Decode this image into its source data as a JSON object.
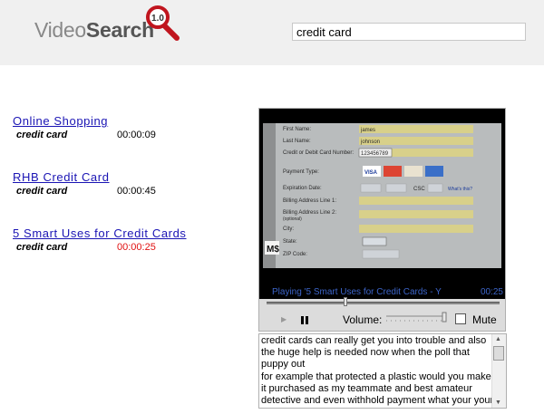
{
  "app": {
    "logo_light": "Video",
    "logo_bold": "Search",
    "version": "1.0"
  },
  "search": {
    "value": "credit card"
  },
  "results": [
    {
      "title": "Online  Shopping",
      "tag": "credit card",
      "time": "00:00:09",
      "active": false
    },
    {
      "title": "RHB  Credit  Card",
      "tag": "credit card",
      "time": "00:00:45",
      "active": false
    },
    {
      "title": "5  Smart  Uses  for  Credit  Cards",
      "tag": "credit card",
      "time": "00:00:25",
      "active": true
    }
  ],
  "player": {
    "now_playing": "Playing '5 Smart Uses for Credit Cards - Y",
    "elapsed": "00:25",
    "seek_fraction": 0.34,
    "volume_label": "Volume:",
    "volume_fraction": 1.0,
    "mute_label": "Mute",
    "muted": false,
    "frame_form": {
      "first_name_label": "First Name:",
      "first_name_value": "james",
      "last_name_label": "Last Name:",
      "last_name_value": "johnson",
      "card_label": "Credit or Debit Card Number:",
      "card_value": "123456789",
      "payment_type_label": "Payment Type:",
      "expiration_label": "Expiration Date:",
      "csc_label": "CSC",
      "whats_this": "What's this?",
      "billing1_label": "Billing Address Line 1:",
      "billing2_label": "Billing Address Line 2:",
      "billing2_note": "(optional)",
      "city_label": "City:",
      "state_label": "State:",
      "zip_label": "ZIP Code:",
      "watermark": "M$"
    }
  },
  "transcript": {
    "lines": [
      "credit cards can really get you into trouble and also",
      "the huge help is needed now when the poll that",
      "puppy out",
      "for example that protected a plastic would you make",
      "it purchased as my teammate and best amateur",
      "detective and even withhold payment what your your"
    ]
  },
  "colors": {
    "header_bg": "#f0f0f0",
    "link": "#1a14b4",
    "active_time": "#e01010",
    "player_bg": "#dcdcdc",
    "now_playing": "#3c64c8",
    "logo_magnifier": "#c0151e"
  }
}
